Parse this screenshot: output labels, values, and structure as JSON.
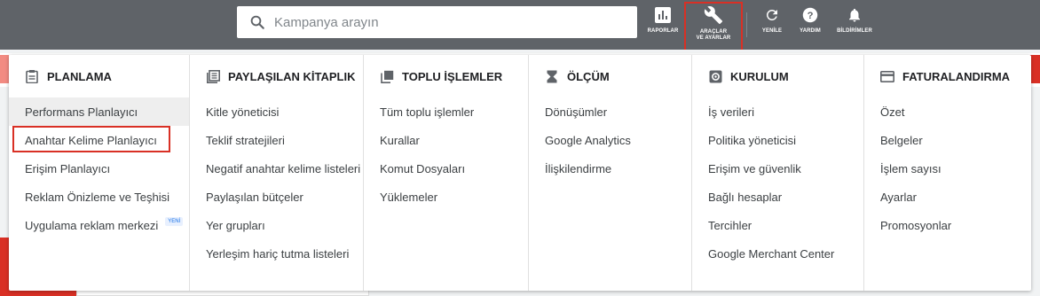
{
  "search": {
    "placeholder": "Kampanya arayın"
  },
  "toolbar": {
    "reports_label": "RAPORLAR",
    "tools_label_line1": "ARAÇLAR",
    "tools_label_line2": "VE AYARLAR",
    "refresh_label": "YENİLE",
    "help_label": "YARDIM",
    "notifications_label": "BİLDİRİMLER"
  },
  "menu": {
    "columns": [
      {
        "title": "PLANLAMA",
        "icon": "clipboard-icon",
        "items": [
          "Performans Planlayıcı",
          "Anahtar Kelime Planlayıcı",
          "Erişim Planlayıcı",
          "Reklam Önizleme ve Teşhisi",
          "Uygulama reklam merkezi"
        ],
        "badge": "YENİ"
      },
      {
        "title": "PAYLAŞILAN KİTAPLIK",
        "icon": "library-icon",
        "items": [
          "Kitle yöneticisi",
          "Teklif stratejileri",
          "Negatif anahtar kelime listeleri",
          "Paylaşılan bütçeler",
          "Yer grupları",
          "Yerleşim hariç tutma listeleri"
        ]
      },
      {
        "title": "TOPLU İŞLEMLER",
        "icon": "copy-icon",
        "items": [
          "Tüm toplu işlemler",
          "Kurallar",
          "Komut Dosyaları",
          "Yüklemeler"
        ]
      },
      {
        "title": "ÖLÇÜM",
        "icon": "hourglass-icon",
        "items": [
          "Dönüşümler",
          "Google Analytics",
          "İlişkilendirme"
        ]
      },
      {
        "title": "KURULUM",
        "icon": "gear-icon",
        "items": [
          "İş verileri",
          "Politika yöneticisi",
          "Erişim ve güvenlik",
          "Bağlı hesaplar",
          "Tercihler",
          "Google Merchant Center"
        ]
      },
      {
        "title": "FATURALANDIRMA",
        "icon": "credit-card-icon",
        "items": [
          "Özet",
          "Belgeler",
          "İşlem sayısı",
          "Ayarlar",
          "Promosyonlar"
        ]
      }
    ]
  }
}
